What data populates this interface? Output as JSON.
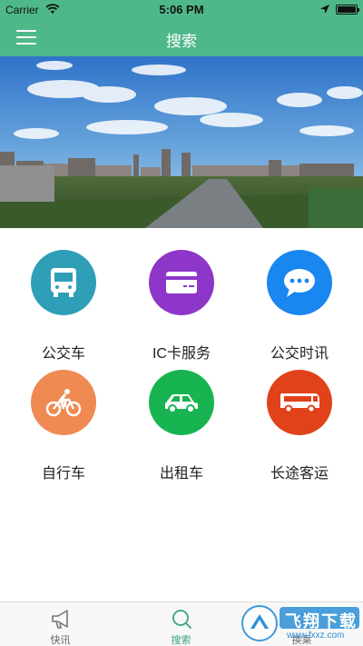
{
  "status": {
    "carrier": "Carrier",
    "time": "5:06 PM"
  },
  "nav": {
    "title": "搜索"
  },
  "services": [
    {
      "label": "公交车",
      "color": "#2f9fb8",
      "icon": "bus-icon"
    },
    {
      "label": "IC卡服务",
      "color": "#8d36c9",
      "icon": "card-icon"
    },
    {
      "label": "公交时讯",
      "color": "#1a86f0",
      "icon": "message-icon"
    },
    {
      "label": "自行车",
      "color": "#ee8a52",
      "icon": "bicycle-icon"
    },
    {
      "label": "出租车",
      "color": "#17b451",
      "icon": "taxi-icon"
    },
    {
      "label": "长途客运",
      "color": "#e0421a",
      "icon": "coach-icon"
    }
  ],
  "tabs": [
    {
      "label": "快讯",
      "icon": "megaphone-icon",
      "active": false
    },
    {
      "label": "搜索",
      "icon": "search-icon",
      "active": true
    },
    {
      "label": "换乘",
      "icon": "transfer-icon",
      "active": false
    }
  ],
  "colors": {
    "brand": "#4fb88a",
    "tab_active": "#3aa57a"
  },
  "watermark": {
    "text": "飞翔下载",
    "url": "www.fxxz.com"
  }
}
